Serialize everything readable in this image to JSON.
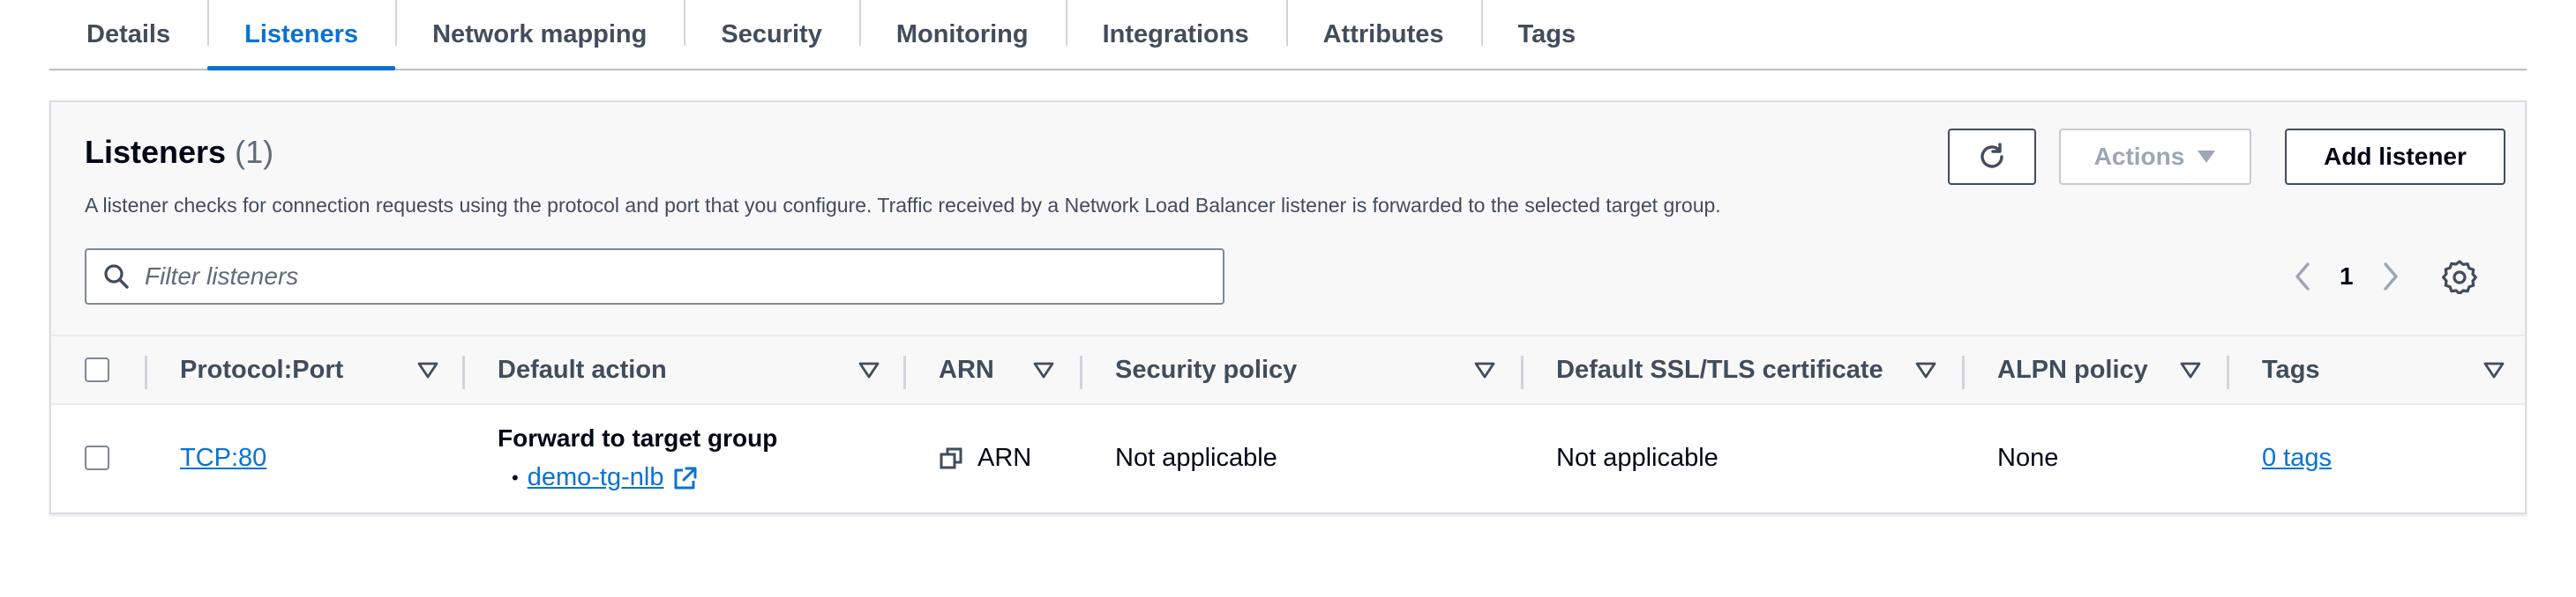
{
  "tabs": [
    {
      "label": "Details",
      "active": false
    },
    {
      "label": "Listeners",
      "active": true
    },
    {
      "label": "Network mapping",
      "active": false
    },
    {
      "label": "Security",
      "active": false
    },
    {
      "label": "Monitoring",
      "active": false
    },
    {
      "label": "Integrations",
      "active": false
    },
    {
      "label": "Attributes",
      "active": false
    },
    {
      "label": "Tags",
      "active": false
    }
  ],
  "header": {
    "title": "Listeners",
    "count": "(1)",
    "description": "A listener checks for connection requests using the protocol and port that you configure. Traffic received by a Network Load Balancer listener is forwarded to the selected target group."
  },
  "buttons": {
    "refresh_icon": "refresh-icon",
    "actions_label": "Actions",
    "add_listener_label": "Add listener"
  },
  "filter": {
    "placeholder": "Filter listeners"
  },
  "pagination": {
    "current_page": "1"
  },
  "table": {
    "columns": [
      "Protocol:Port",
      "Default action",
      "ARN",
      "Security policy",
      "Default SSL/TLS certificate",
      "ALPN policy",
      "Tags"
    ],
    "rows": [
      {
        "protocol_port": "TCP:80",
        "default_action_title": "Forward to target group",
        "target_group": "demo-tg-nlb",
        "arn": "ARN",
        "security_policy": "Not applicable",
        "ssl_certificate": "Not applicable",
        "alpn_policy": "None",
        "tags": "0 tags"
      }
    ]
  },
  "colors": {
    "accent": "#0972d3",
    "text": "#000716",
    "muted": "#414d5c"
  }
}
